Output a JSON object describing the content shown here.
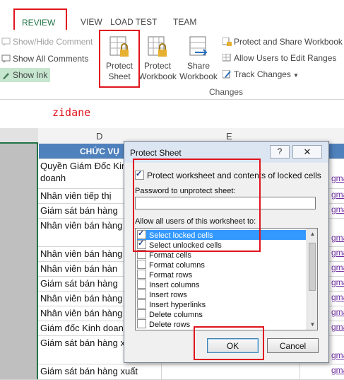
{
  "ribbon": {
    "tabs": {
      "review": "REVIEW",
      "view": "VIEW",
      "load_test": "LOAD TEST",
      "team": "TEAM"
    },
    "comments": {
      "show_hide": "Show/Hide Comment",
      "show_all": "Show All Comments",
      "show_ink": "Show Ink"
    },
    "protect_sheet": [
      "Protect",
      "Sheet"
    ],
    "protect_workbook": [
      "Protect",
      "Workbook"
    ],
    "share_workbook": [
      "Share",
      "Workbook"
    ],
    "protect_share": "Protect and Share Workbook",
    "allow_users": "Allow Users to Edit Ranges",
    "track_changes": "Track Changes",
    "group_label": "Changes"
  },
  "annotation": "zidane",
  "grid": {
    "col_d": "D",
    "col_e": "E",
    "header": "CHỨC VỤ",
    "rows": [
      {
        "d": "Quyền Giám Đốc Kinh doanh",
        "f": "gma",
        "h": 42
      },
      {
        "d": "Nhân viên tiếp thị",
        "f": "gma",
        "h": 21
      },
      {
        "d": "Giám sát bán hàng",
        "f": "gma",
        "h": 21
      },
      {
        "d": "Nhân viên bán hàng",
        "f": "gma",
        "h": 40
      },
      {
        "d": "Nhân viên bán hàng",
        "f": "gma",
        "h": 21
      },
      {
        "d": "Nhân viên bán hàn",
        "f": "gma",
        "h": 21
      },
      {
        "d": "Giám sát bán hàng",
        "f": "gma",
        "h": 21
      },
      {
        "d": "Nhân viên bán hàng",
        "f": "gma",
        "h": 21
      },
      {
        "d": "Nhân viên bán hàng",
        "f": "gma",
        "h": 21
      },
      {
        "d": "Giám đốc Kinh doan",
        "f": "gma",
        "h": 21
      },
      {
        "d": "Giám sát bán hàng x khẩu",
        "f": "gma",
        "h": 40
      },
      {
        "d": "Giám sát bán hàng xuất",
        "f": "gma",
        "h": 22
      }
    ]
  },
  "dialog": {
    "title": "Protect Sheet",
    "help": "?",
    "close": "✕",
    "protect_label": "Protect worksheet and contents of locked cells",
    "password_label": "Password to unprotect sheet:",
    "password_value": "",
    "allow_label": "Allow all users of this worksheet to:",
    "permissions": [
      {
        "label": "Select locked cells",
        "checked": true,
        "selected": true
      },
      {
        "label": "Select unlocked cells",
        "checked": true,
        "selected": false
      },
      {
        "label": "Format cells",
        "checked": false,
        "selected": false
      },
      {
        "label": "Format columns",
        "checked": false,
        "selected": false
      },
      {
        "label": "Format rows",
        "checked": false,
        "selected": false
      },
      {
        "label": "Insert columns",
        "checked": false,
        "selected": false
      },
      {
        "label": "Insert rows",
        "checked": false,
        "selected": false
      },
      {
        "label": "Insert hyperlinks",
        "checked": false,
        "selected": false
      },
      {
        "label": "Delete columns",
        "checked": false,
        "selected": false
      },
      {
        "label": "Delete rows",
        "checked": false,
        "selected": false
      }
    ],
    "ok": "OK",
    "cancel": "Cancel"
  },
  "colors": {
    "accent": "#217346",
    "highlight": "#e0141e",
    "header_fill": "#4f81bd",
    "selection": "#3399ff"
  }
}
